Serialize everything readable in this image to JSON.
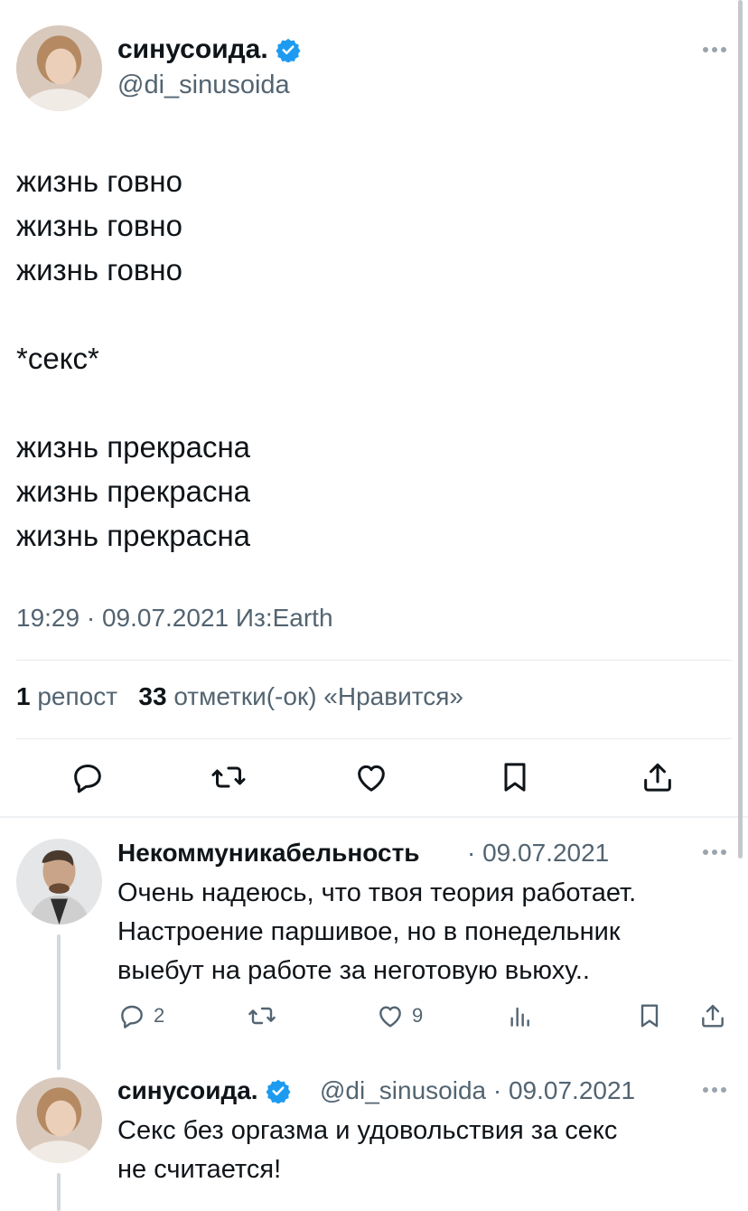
{
  "colors": {
    "accent": "#1d9bf0",
    "text": "#0f1419",
    "secondary": "#536471",
    "divider": "#e6ecf0"
  },
  "main_tweet": {
    "author_name": "синусоида.",
    "author_handle": "@di_sinusoida",
    "verified": true,
    "text": "жизнь говно\nжизнь говно\nжизнь говно\n\n*секс*\n\nжизнь прекрасна\nжизнь прекрасна\nжизнь прекрасна",
    "timestamp": "19:29 · 09.07.2021 Из:Earth",
    "reposts_count": "1",
    "reposts_label": "репост",
    "likes_count": "33",
    "likes_label": "отметки(-ок) «Нравится»",
    "actions": [
      "reply-icon",
      "repost-icon",
      "like-icon",
      "bookmark-icon",
      "share-icon"
    ]
  },
  "replies": [
    {
      "author_name": "Некоммуникабельность",
      "meta": "· 09.07.2021",
      "text": "Очень надеюсь, что твоя теория работает.\nНастроение паршивое, но в понедельник\nвыебут на работе за неготовую вьюху..",
      "reply_count": "2",
      "repost_count": "",
      "like_count": "9"
    },
    {
      "author_name": "синусоида.",
      "verified": true,
      "meta": "@di_sinusoida · 09.07.2021",
      "text": "Секс без оргазма и удовольствия за секс\nне считается!"
    }
  ]
}
